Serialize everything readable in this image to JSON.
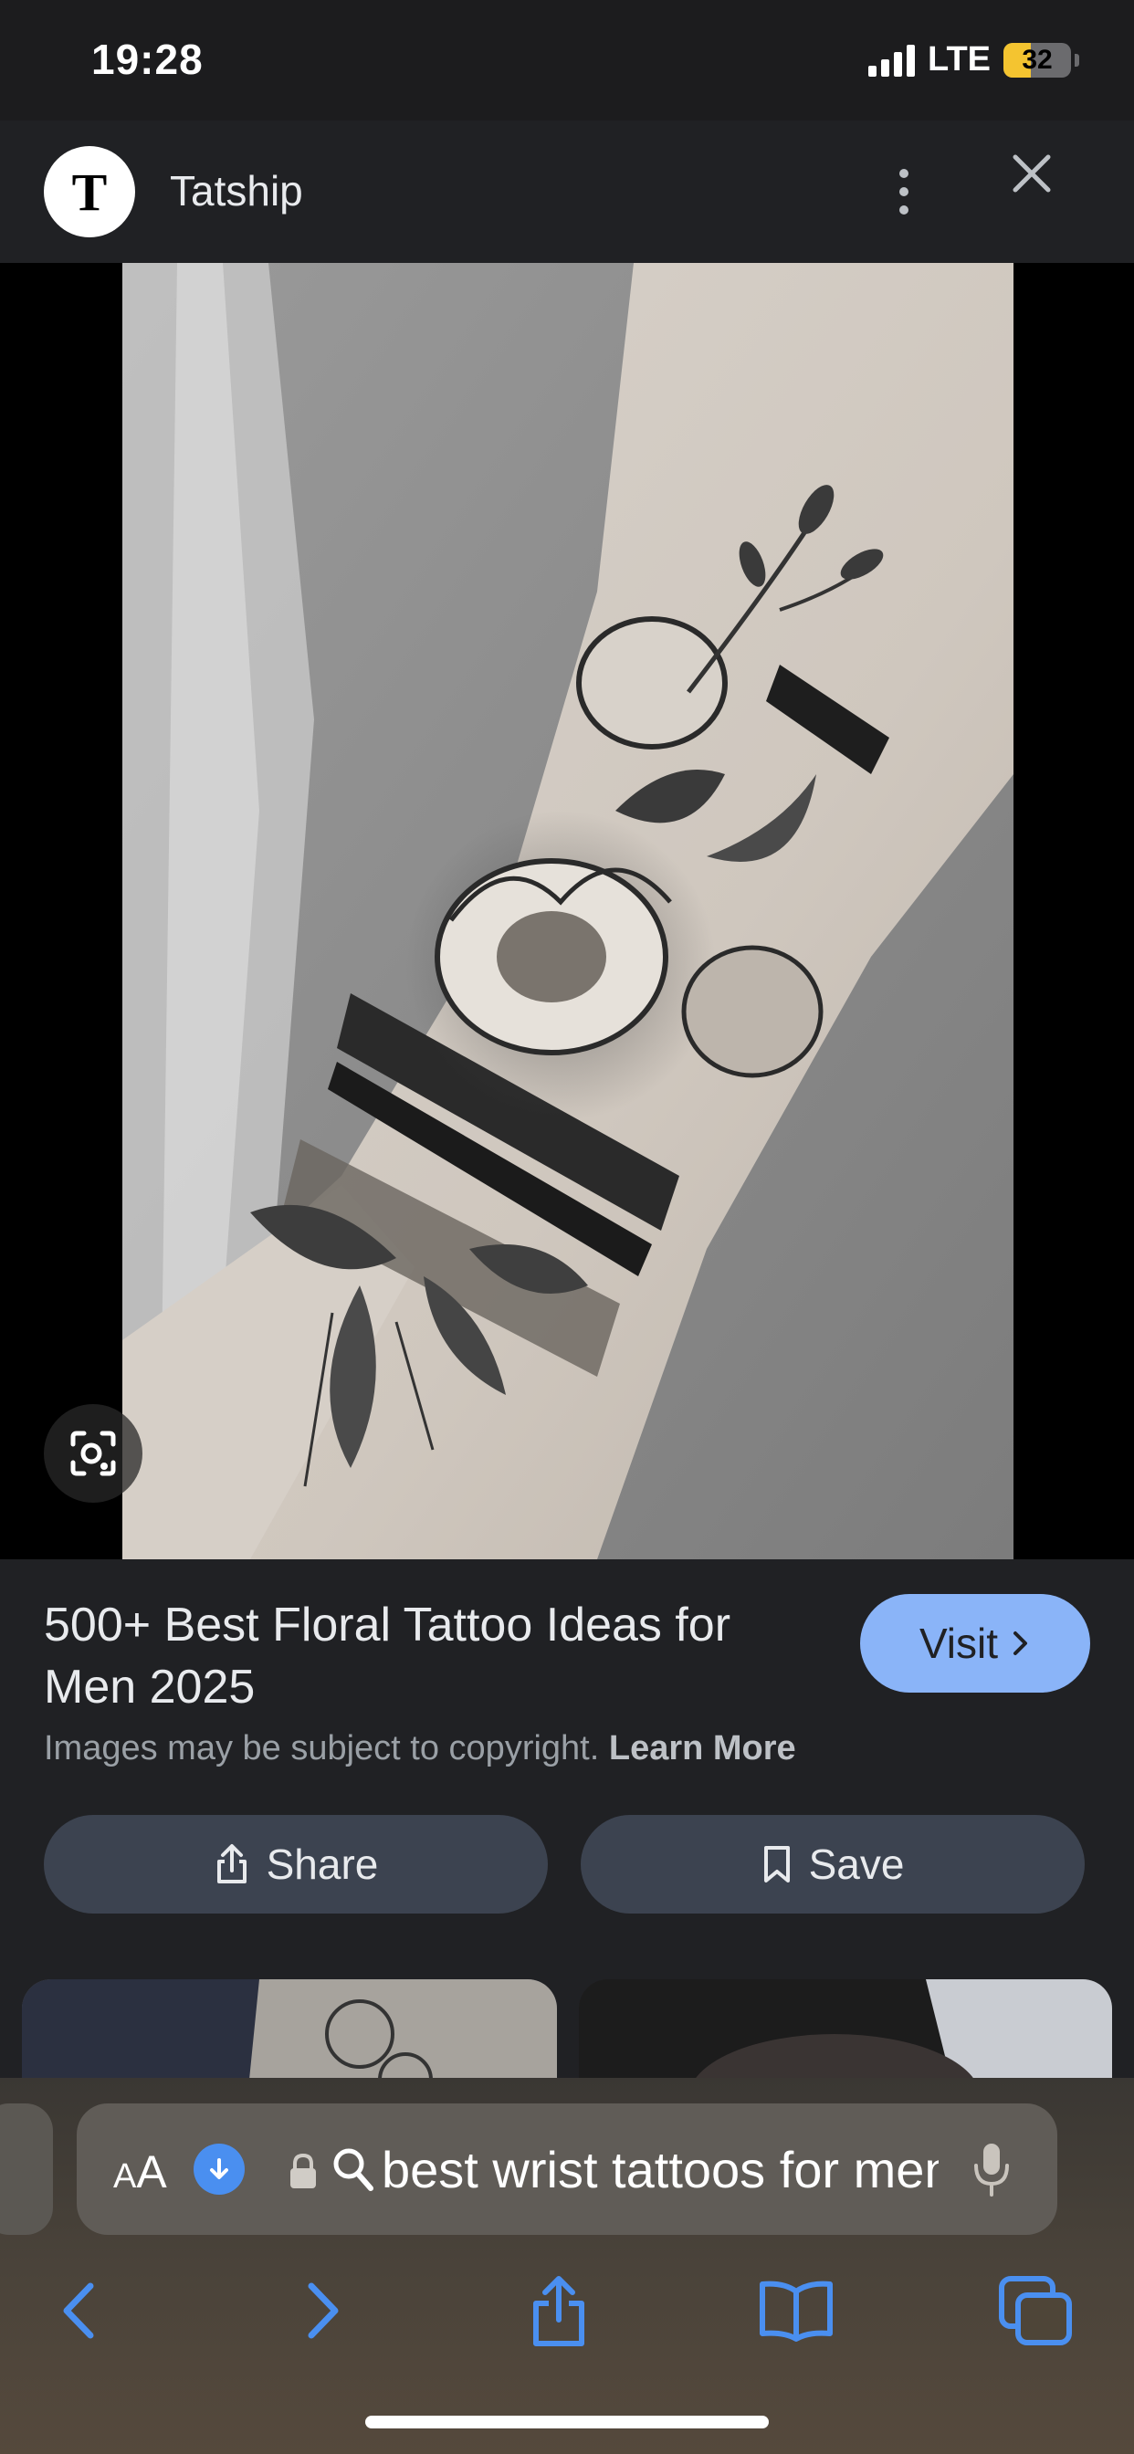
{
  "status_bar": {
    "time": "19:28",
    "network": "LTE",
    "battery": "32"
  },
  "header": {
    "logo_letter": "T",
    "site_name": "Tatship"
  },
  "image": {
    "description_icon": "google-lens-icon"
  },
  "result": {
    "title": "500+ Best Floral Tattoo Ideas for Men 2025",
    "visit_label": "Visit",
    "copyright_text": "Images may be subject to copyright.",
    "learn_more": "Learn More",
    "share_label": "Share",
    "save_label": "Save"
  },
  "browser": {
    "aa_label": "AA",
    "query": "best wrist tattoos for men",
    "accent": "#4a8ff0"
  },
  "colors": {
    "visit_button": "#8ab4f8",
    "action_button": "#3c4350",
    "background": "#202124"
  }
}
